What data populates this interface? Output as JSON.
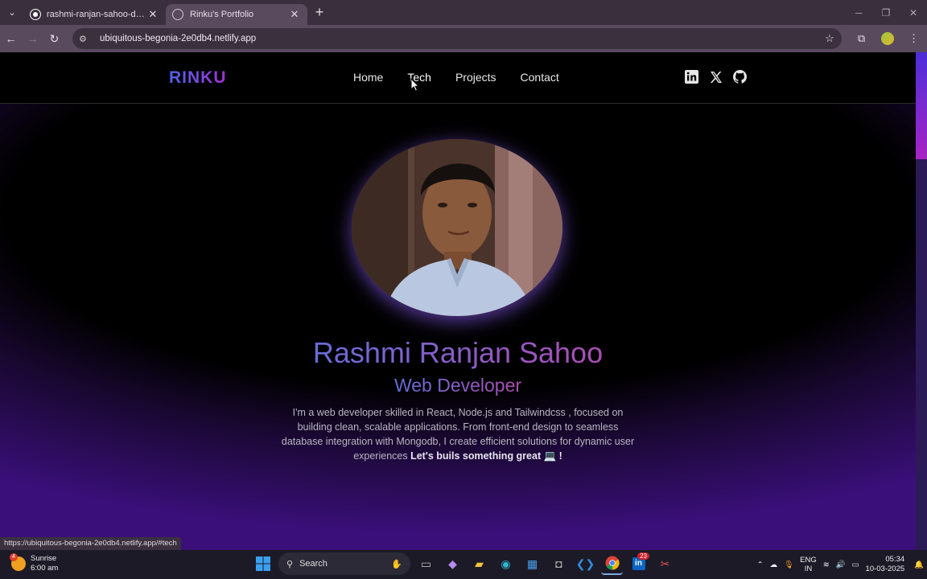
{
  "browser": {
    "tabs": [
      {
        "title": "rashmi-ranjan-sahoo-dev/Portf",
        "icon": "github-icon",
        "active": false
      },
      {
        "title": "Rinku's Portfolio",
        "icon": "globe-icon",
        "active": true
      }
    ],
    "url": "ubiquitous-begonia-2e0db4.netlify.app",
    "status_url": "https://ubiquitous-begonia-2e0db4.netlify.app/#tech"
  },
  "site": {
    "logo": "RINKU",
    "nav": [
      "Home",
      "Tech",
      "Projects",
      "Contact"
    ],
    "socials": [
      "linkedin-icon",
      "x-twitter-icon",
      "github-icon"
    ],
    "name": "Rashmi Ranjan Sahoo",
    "role": "Web Developer",
    "bio_text": "I'm a web developer skilled in React, Node.js and Tailwindcss , focused on building clean, scalable applications. From front-end design to seamless database integration with Mongodb, I create efficient solutions for dynamic user experiences",
    "bio_cta": "Let's buils something great 💻 !",
    "colors": {
      "accent_blue": "#4a7ae8",
      "accent_pink": "#c93fa5",
      "bg_purple": "#3a0f7a"
    }
  },
  "taskbar": {
    "weather_title": "Sunrise",
    "weather_sub": "6:00 am",
    "weather_badge": "4",
    "search": "Search",
    "linkedin_badge": "23",
    "lang_1": "ENG",
    "lang_2": "IN",
    "time": "05:34",
    "date": "10-03-2025"
  }
}
